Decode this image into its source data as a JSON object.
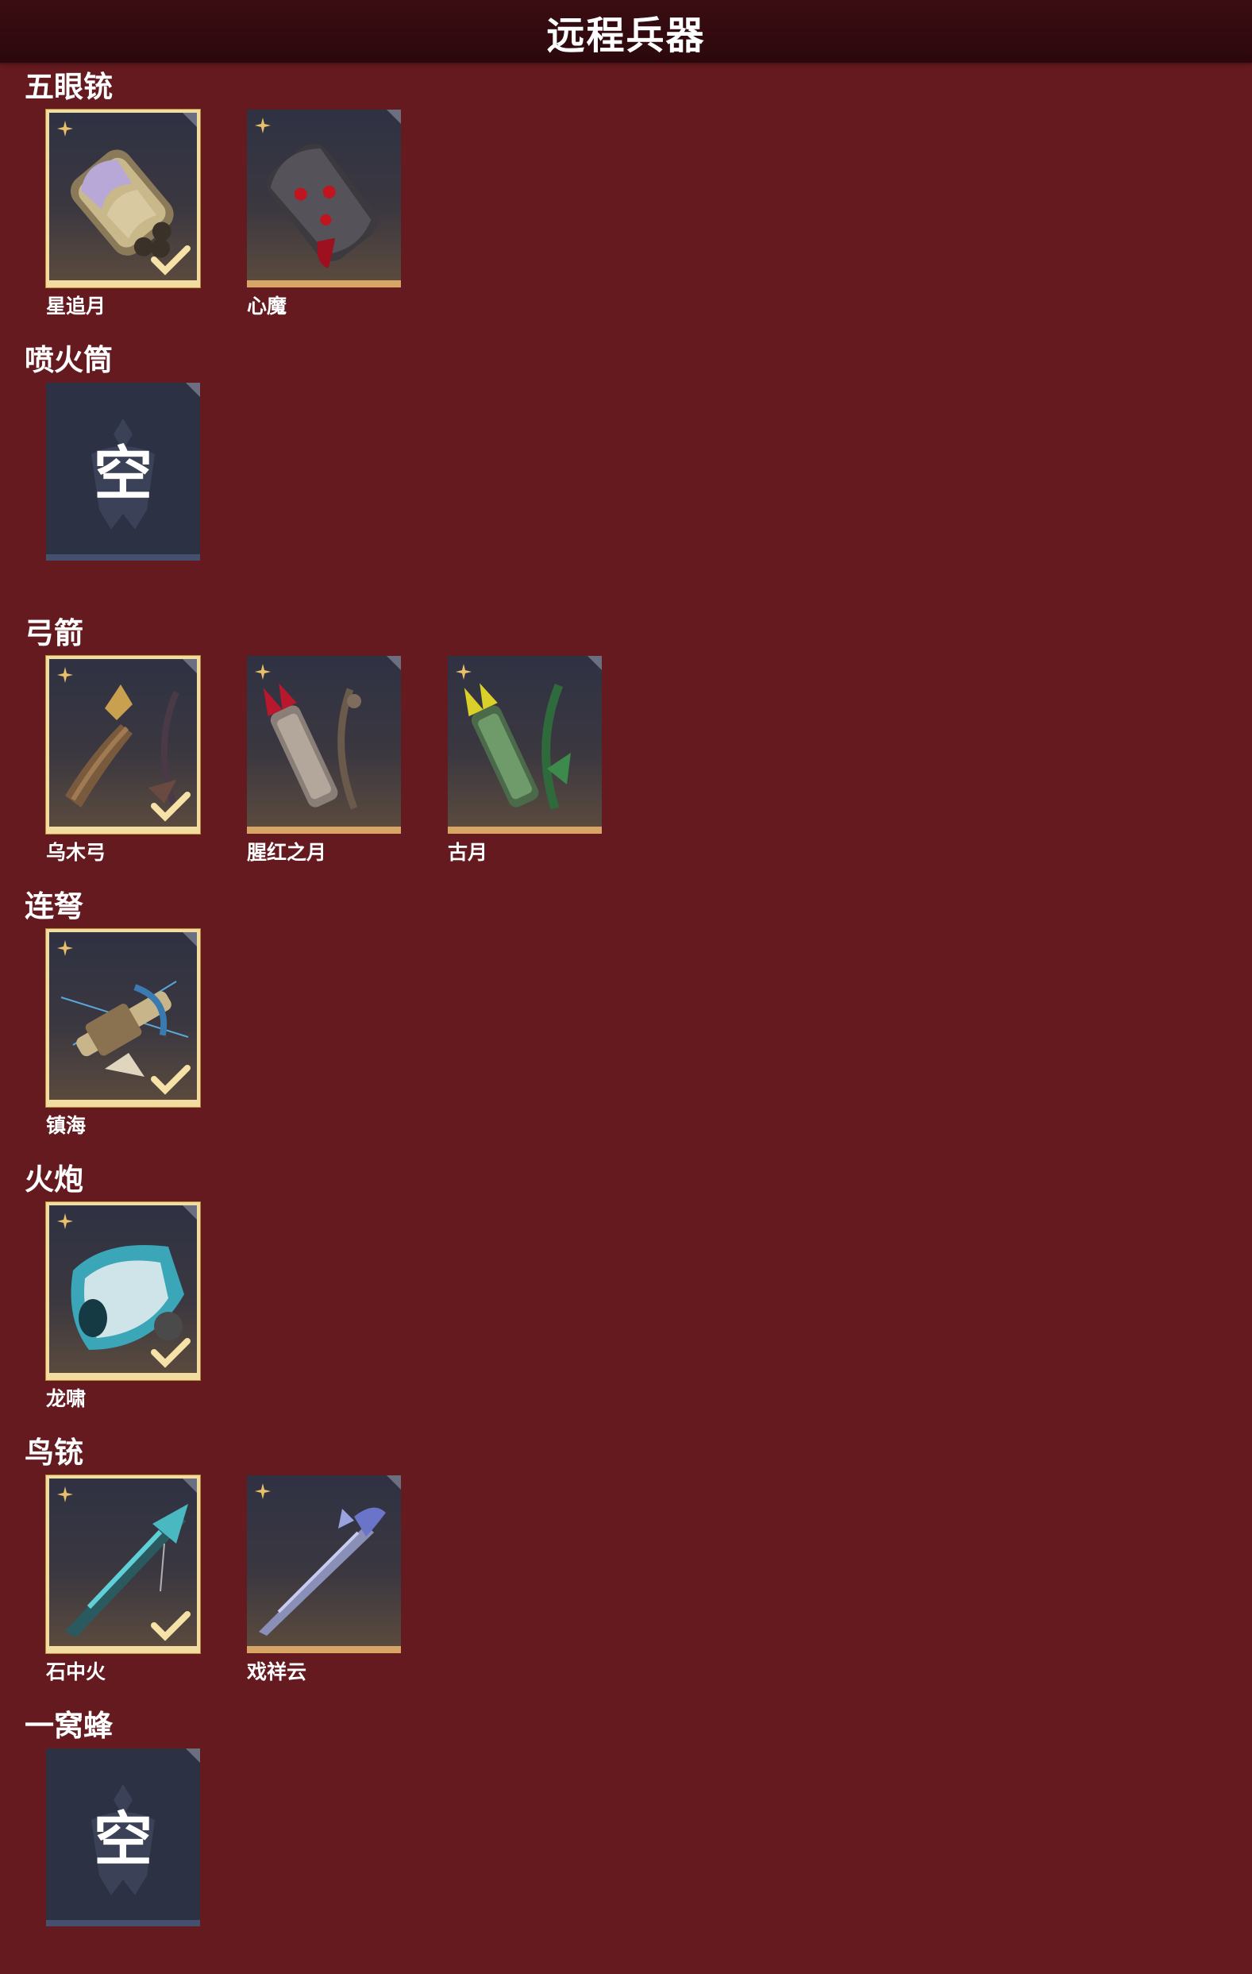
{
  "header": {
    "title": "远程兵器"
  },
  "sections": [
    {
      "title": "五眼铳",
      "slots": [
        {
          "label": "星追月",
          "equipped": true,
          "art": "gatling-gun"
        },
        {
          "label": "心魔",
          "equipped": false,
          "art": "dark-gun"
        }
      ]
    },
    {
      "title": "喷火筒",
      "slots": [
        {
          "label": "",
          "empty": true,
          "empty_char": "空"
        }
      ]
    },
    {
      "title": "弓箭",
      "slots": [
        {
          "label": "乌木弓",
          "equipped": true,
          "art": "wood-bow"
        },
        {
          "label": "腥红之月",
          "equipped": false,
          "art": "red-quiver-bow"
        },
        {
          "label": "古月",
          "equipped": false,
          "art": "green-quiver-bow"
        }
      ]
    },
    {
      "title": "连弩",
      "slots": [
        {
          "label": "镇海",
          "equipped": true,
          "art": "crossbow"
        }
      ]
    },
    {
      "title": "火炮",
      "slots": [
        {
          "label": "龙啸",
          "equipped": true,
          "art": "dragon-cannon"
        }
      ]
    },
    {
      "title": "鸟铳",
      "slots": [
        {
          "label": "石中火",
          "equipped": true,
          "art": "jade-musket"
        },
        {
          "label": "戏祥云",
          "equipped": false,
          "art": "silver-musket"
        }
      ]
    },
    {
      "title": "一窝蜂",
      "slots": [
        {
          "label": "",
          "empty": true,
          "empty_char": "空"
        }
      ]
    }
  ],
  "colors": {
    "background": "#641a1f",
    "header": "#2b080c",
    "card": "#2f3243",
    "gold": "#d8a567",
    "equipped_border": "#f3dca0",
    "empty_card": "#2c3144"
  }
}
